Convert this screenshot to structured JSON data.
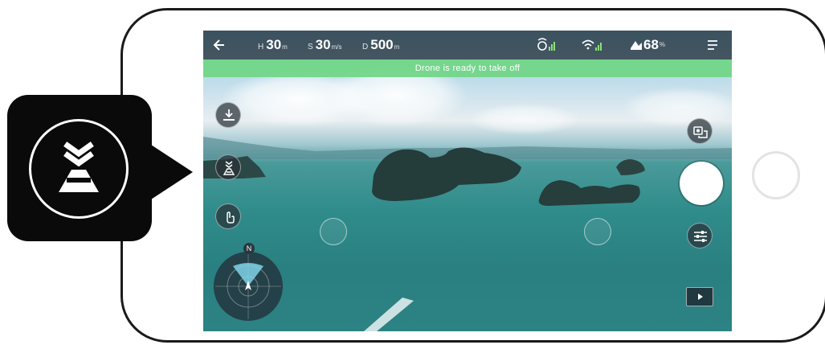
{
  "telemetry": {
    "height": {
      "label": "H",
      "value": "30",
      "unit": "m"
    },
    "speed": {
      "label": "S",
      "value": "30",
      "unit": "m/s"
    },
    "distance": {
      "label": "D",
      "value": "500",
      "unit": "m"
    }
  },
  "battery": {
    "value": "68",
    "unit": "%"
  },
  "status_message": "Drone is ready to take off",
  "radar": {
    "north_label": "N"
  },
  "colors": {
    "status_green": "#70d684",
    "hud_dark": "#1c242c",
    "water": "#2f8c8a"
  },
  "icons": [
    "back-arrow-icon",
    "drone-signal-icon",
    "wifi-signal-icon",
    "drone-battery-icon",
    "menu-icon",
    "landing-icon",
    "take-off-icon",
    "gesture-icon",
    "camera-switch-icon",
    "settings-sliders-icon",
    "play-icon"
  ]
}
